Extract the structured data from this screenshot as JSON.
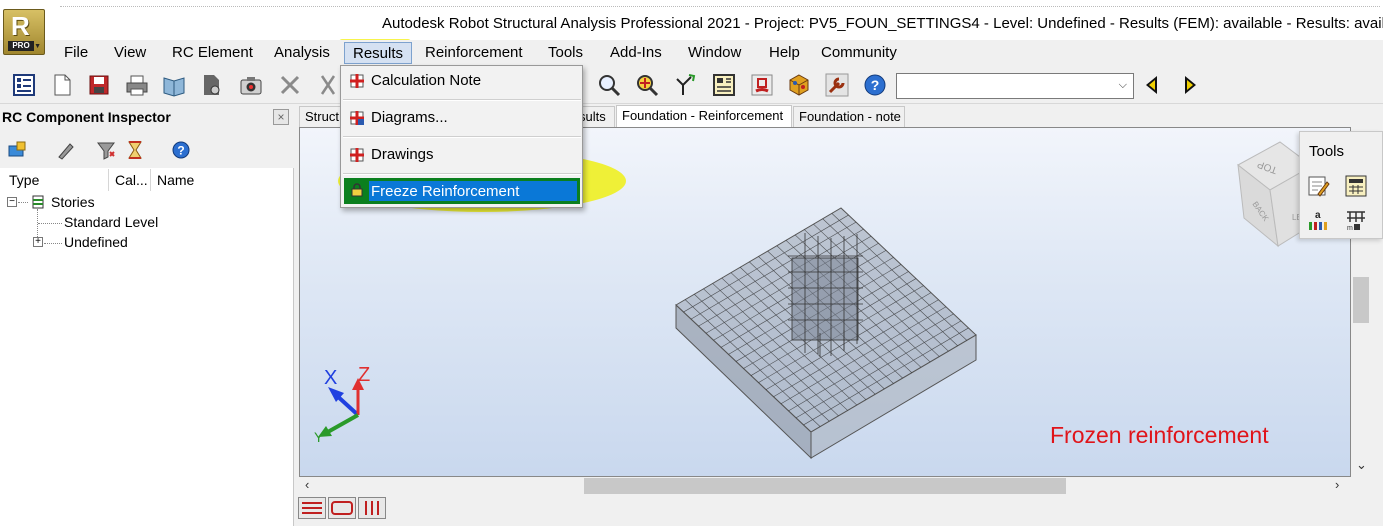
{
  "window": {
    "title": "Autodesk Robot Structural Analysis Professional 2021 - Project: PV5_FOUN_SETTINGS4 - Level: Undefined - Results (FEM): available - Results: available -",
    "logo_letter": "R",
    "logo_badge": "PRO"
  },
  "menu": {
    "items": [
      "File",
      "View",
      "RC Element",
      "Analysis",
      "Results",
      "Reinforcement",
      "Tools",
      "Add-Ins",
      "Window",
      "Help",
      "Community"
    ],
    "active": "Results"
  },
  "results_menu": {
    "items": [
      "Calculation Note",
      "Diagrams...",
      "Drawings",
      "Freeze Reinforcement"
    ],
    "selected": "Freeze Reinforcement"
  },
  "toolbar": {
    "combo_value": ""
  },
  "inspector": {
    "title": "RC Component Inspector",
    "close": "×",
    "columns": [
      "Type",
      "Cal...",
      "Name"
    ],
    "tree": {
      "root": "Stories",
      "children": [
        "Standard Level",
        "Undefined"
      ]
    }
  },
  "tabs": {
    "items": [
      "Struct",
      "sults",
      "Foundation - Reinforcement",
      "Foundation - note"
    ],
    "active": "Foundation - Reinforcement"
  },
  "viewport": {
    "axis_x": "X",
    "axis_z": "Z",
    "axis_y": "Y",
    "annotation": "Frozen reinforcement",
    "annotation_color": "#e0141a",
    "viewcube_top": "TOP",
    "viewcube_back": "BACK",
    "viewcube_left": "LE"
  },
  "tools_panel": {
    "title": "Tools"
  },
  "colors": {
    "highlight": "#f4f000",
    "selection": "#0a78d7"
  }
}
